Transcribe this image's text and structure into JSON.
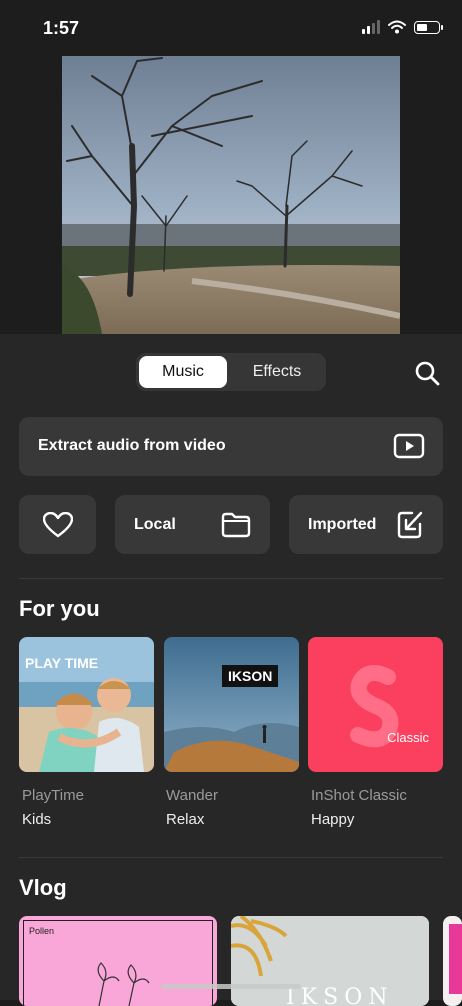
{
  "status": {
    "time": "1:57"
  },
  "tabs": {
    "music": "Music",
    "effects": "Effects"
  },
  "extract": {
    "label": "Extract audio from video"
  },
  "quick": {
    "local": "Local",
    "imported": "Imported"
  },
  "sections": {
    "for_you": "For you",
    "vlog": "Vlog"
  },
  "cards": [
    {
      "overlay": "PLAY TIME",
      "sub": "PlayTime",
      "name": "Kids"
    },
    {
      "overlay": "IKSON",
      "sub": "Wander",
      "name": "Relax"
    },
    {
      "overlay": "Classic",
      "sub": "InShot Classic",
      "name": "Happy"
    }
  ],
  "vlog_cards": [
    {
      "overlay": "Pollen"
    }
  ],
  "icons": {
    "search": "search-icon",
    "play": "play-box-icon",
    "heart": "heart-icon",
    "folder": "folder-icon",
    "import": "import-arrow-icon"
  },
  "colors": {
    "panel": "#272727",
    "tile": "#383838",
    "classic_card": "#fb3f5f",
    "pollen_card": "#f9a6d8"
  }
}
